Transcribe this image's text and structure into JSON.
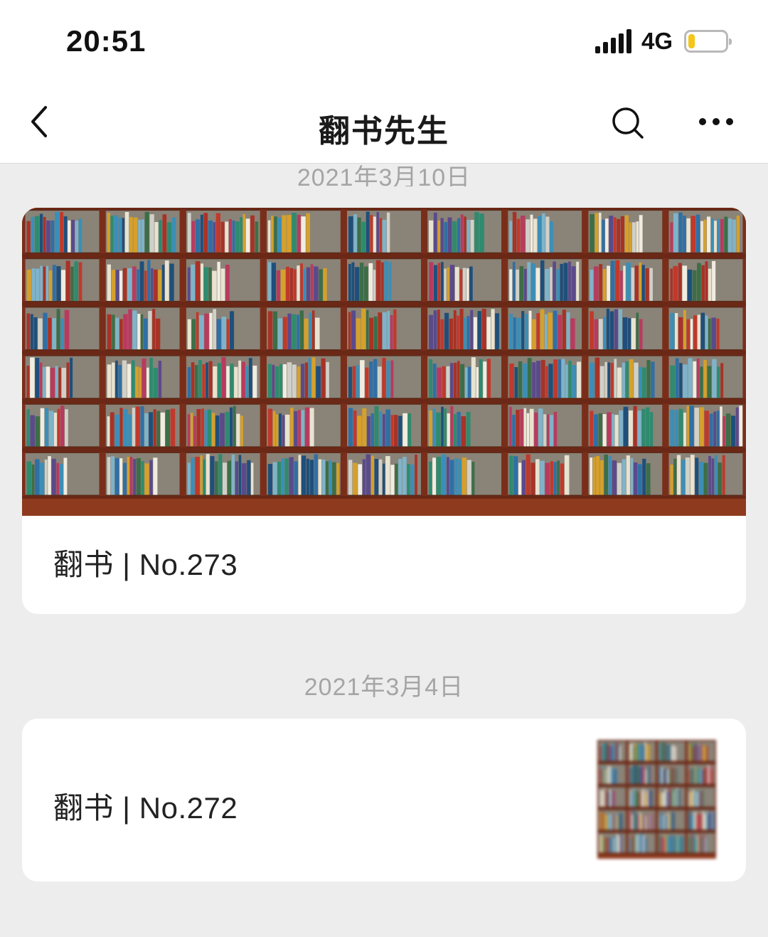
{
  "status_bar": {
    "time": "20:51",
    "network": "4G",
    "battery_level": 0.18,
    "battery_color": "#f5c518"
  },
  "nav": {
    "back_icon": "chevron-left-icon",
    "title": "翻书先生",
    "search_icon": "search-icon",
    "more_icon": "more-horizontal-icon"
  },
  "feed": [
    {
      "date": "2021年3月10日",
      "title": "翻书 | No.273",
      "image": "bookshelf-cover"
    },
    {
      "date": "2021年3月4日",
      "title": "翻书 | No.272",
      "image": "bookshelf-thumbnail"
    }
  ]
}
